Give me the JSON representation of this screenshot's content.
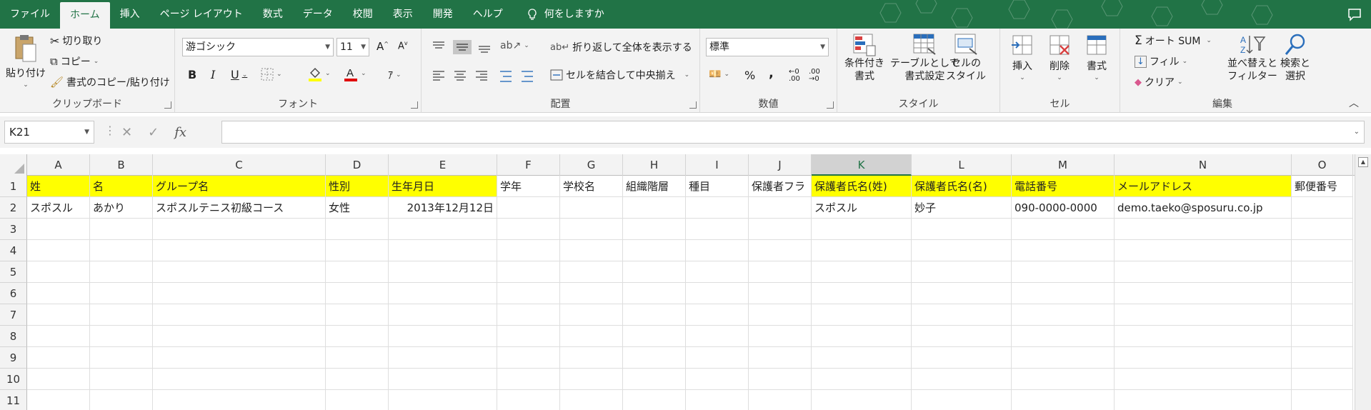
{
  "tabs": [
    {
      "label": "ファイル",
      "active": false
    },
    {
      "label": "ホーム",
      "active": true
    },
    {
      "label": "挿入",
      "active": false
    },
    {
      "label": "ページ レイアウト",
      "active": false
    },
    {
      "label": "数式",
      "active": false
    },
    {
      "label": "データ",
      "active": false
    },
    {
      "label": "校閲",
      "active": false
    },
    {
      "label": "表示",
      "active": false
    },
    {
      "label": "開発",
      "active": false
    },
    {
      "label": "ヘルプ",
      "active": false
    }
  ],
  "tell_me": "何をしますか",
  "ribbon": {
    "clipboard": {
      "label": "クリップボード",
      "paste": "貼り付け",
      "cut": "切り取り",
      "copy": "コピー",
      "format_painter": "書式のコピー/貼り付け"
    },
    "font": {
      "label": "フォント",
      "font_name": "游ゴシック",
      "font_size": "11",
      "bold": "B",
      "italic": "I",
      "underline": "U"
    },
    "alignment": {
      "label": "配置",
      "wrap_text": "折り返して全体を表示する",
      "merge_center": "セルを結合して中央揃え"
    },
    "number": {
      "label": "数値",
      "format": "標準",
      "percent": "%",
      "comma": ","
    },
    "styles": {
      "label": "スタイル",
      "conditional": [
        "条件付き",
        "書式"
      ],
      "as_table": [
        "テーブルとして",
        "書式設定"
      ],
      "cell_styles": [
        "セルの",
        "スタイル"
      ]
    },
    "cells": {
      "label": "セル",
      "insert": "挿入",
      "delete": "削除",
      "format": "書式"
    },
    "editing": {
      "label": "編集",
      "autosum": "オート SUM",
      "fill": "フィル",
      "clear": "クリア",
      "sort_filter": [
        "並べ替えと",
        "フィルター"
      ],
      "find_select": [
        "検索と",
        "選択"
      ]
    }
  },
  "formula_bar": {
    "name_box": "K21",
    "fx": "fx",
    "formula": ""
  },
  "columns": [
    "A",
    "B",
    "C",
    "D",
    "E",
    "F",
    "G",
    "H",
    "I",
    "J",
    "K",
    "L",
    "M",
    "N",
    "O"
  ],
  "selected_column": "K",
  "rows": [
    "1",
    "2",
    "3",
    "4",
    "5",
    "6",
    "7",
    "8",
    "9",
    "10",
    "11"
  ],
  "header_row": [
    "姓",
    "名",
    "グループ名",
    "性別",
    "生年月日",
    "学年",
    "学校名",
    "組織階層",
    "種目",
    "保護者フラ",
    "保護者氏名(姓)",
    "保護者氏名(名)",
    "電話番号",
    "メールアドレス",
    "郵便番号"
  ],
  "highlighted_header_columns": [
    "A",
    "B",
    "C",
    "D",
    "E",
    "K",
    "L",
    "M",
    "N"
  ],
  "data_row": [
    "スポスル",
    "あかり",
    "スポスルテニス初級コース",
    "女性",
    "2013年12月12日",
    "",
    "",
    "",
    "",
    "",
    "スポスル",
    "妙子",
    "090-0000-0000",
    "demo.taeko@sposuru.co.jp",
    ""
  ],
  "colors": {
    "brand": "#217346",
    "highlight": "#ffff00"
  }
}
